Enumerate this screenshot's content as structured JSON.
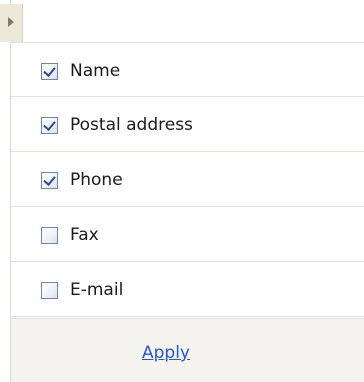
{
  "panel": {
    "toggle": {
      "icon": "triangle-right-icon"
    },
    "options": [
      {
        "label": "Name",
        "checked": true
      },
      {
        "label": "Postal address",
        "checked": true
      },
      {
        "label": "Phone",
        "checked": true
      },
      {
        "label": "Fax",
        "checked": false
      },
      {
        "label": "E-mail",
        "checked": false
      }
    ],
    "apply_label": "Apply"
  }
}
